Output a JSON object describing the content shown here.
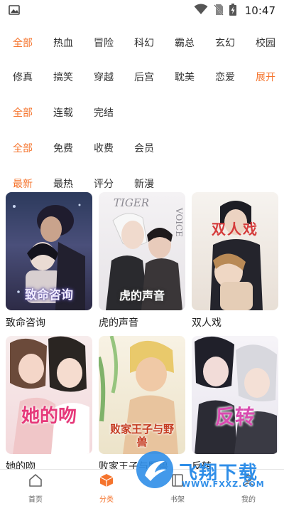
{
  "status_bar": {
    "time": "10:47"
  },
  "filters": {
    "genre_row1": [
      "全部",
      "热血",
      "冒险",
      "科幻",
      "霸总",
      "玄幻",
      "校园"
    ],
    "genre_row2": [
      "修真",
      "搞笑",
      "穿越",
      "后宫",
      "耽美",
      "恋爱"
    ],
    "expand_label": "展开",
    "status_row": [
      "全部",
      "连载",
      "完结"
    ],
    "price_row": [
      "全部",
      "免费",
      "收费",
      "会员"
    ],
    "sort_row": [
      "最新",
      "最热",
      "评分",
      "新漫"
    ]
  },
  "comics": [
    {
      "title": "致命咨询",
      "cover_text": "致命咨询"
    },
    {
      "title": "虎的声音",
      "cover_text": "虎的声音",
      "cover_subtext": "TIGER",
      "cover_side": "VOICE"
    },
    {
      "title": "双人戏",
      "cover_text": "双人戏"
    },
    {
      "title": "她的吻",
      "cover_text": "她的吻"
    },
    {
      "title": "败家王子与野兽",
      "cover_text": "败家王子与野兽"
    },
    {
      "title": "反转",
      "cover_text": "反转"
    }
  ],
  "bottom_nav": {
    "home": "首页",
    "category": "分类",
    "bookshelf": "书架",
    "mine": "我的"
  },
  "watermark": {
    "text": "飞翔下载",
    "url": "WWW.FXXZ.COM"
  },
  "colors": {
    "accent": "#f5742d",
    "watermark": "#2f8ee8"
  }
}
